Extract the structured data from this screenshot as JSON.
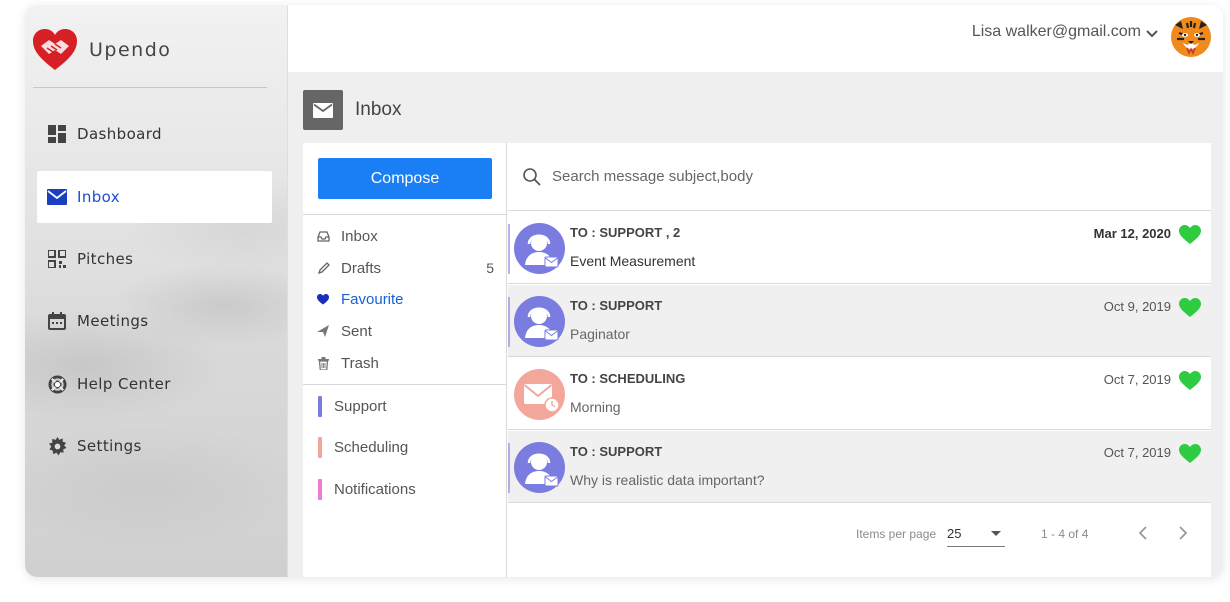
{
  "brand": {
    "name": "Upendo",
    "logo_icon": "heart-handshake-logo"
  },
  "sidebar": {
    "items": [
      {
        "label": "Dashboard",
        "icon": "dashboard-icon"
      },
      {
        "label": "Inbox",
        "icon": "mail-icon",
        "active": true
      },
      {
        "label": "Pitches",
        "icon": "qr-code-icon"
      },
      {
        "label": "Meetings",
        "icon": "calendar-icon"
      },
      {
        "label": "Help Center",
        "icon": "lifebuoy-icon"
      },
      {
        "label": "Settings",
        "icon": "gear-icon"
      }
    ]
  },
  "header": {
    "user_email": "Lisa walker@gmail.com",
    "avatar": "tiger-avatar"
  },
  "page": {
    "title": "Inbox",
    "icon": "mail-icon"
  },
  "compose": {
    "label": "Compose"
  },
  "folders": [
    {
      "label": "Inbox",
      "icon": "inbox-tray-icon"
    },
    {
      "label": "Drafts",
      "icon": "pencil-icon",
      "count": "5"
    },
    {
      "label": "Favourite",
      "icon": "heart-icon",
      "active": true
    },
    {
      "label": "Sent",
      "icon": "send-icon"
    },
    {
      "label": "Trash",
      "icon": "trash-icon"
    }
  ],
  "labels": [
    {
      "label": "Support",
      "color": "#7b7ce0"
    },
    {
      "label": "Scheduling",
      "color": "#f2a79a"
    },
    {
      "label": "Notifications",
      "color": "#f07ad8"
    }
  ],
  "search": {
    "placeholder": "Search message subject,body"
  },
  "messages": [
    {
      "to": "TO : SUPPORT  , 2",
      "subject": "Event Measurement",
      "date": "Mar 12, 2020",
      "avatar": "support-agent-avatar",
      "favourite": true
    },
    {
      "to": "TO : SUPPORT",
      "subject": "Paginator",
      "date": "Oct 9, 2019",
      "avatar": "support-agent-avatar",
      "favourite": true
    },
    {
      "to": "TO : SCHEDULING",
      "subject": "Morning",
      "date": "Oct 7, 2019",
      "avatar": "scheduled-mail-avatar",
      "favourite": true
    },
    {
      "to": "TO : SUPPORT",
      "subject": "Why is realistic data important?",
      "date": "Oct 7, 2019",
      "avatar": "support-agent-avatar",
      "favourite": true
    }
  ],
  "paginator": {
    "items_per_page_label": "Items per page",
    "page_size": "25",
    "range_label": "1 - 4 of 4"
  },
  "colors": {
    "accent": "#1a7ff5",
    "favourite": "#2ecc40",
    "support_avatar": "#7b7ce0",
    "scheduling_avatar": "#f2a79a"
  }
}
